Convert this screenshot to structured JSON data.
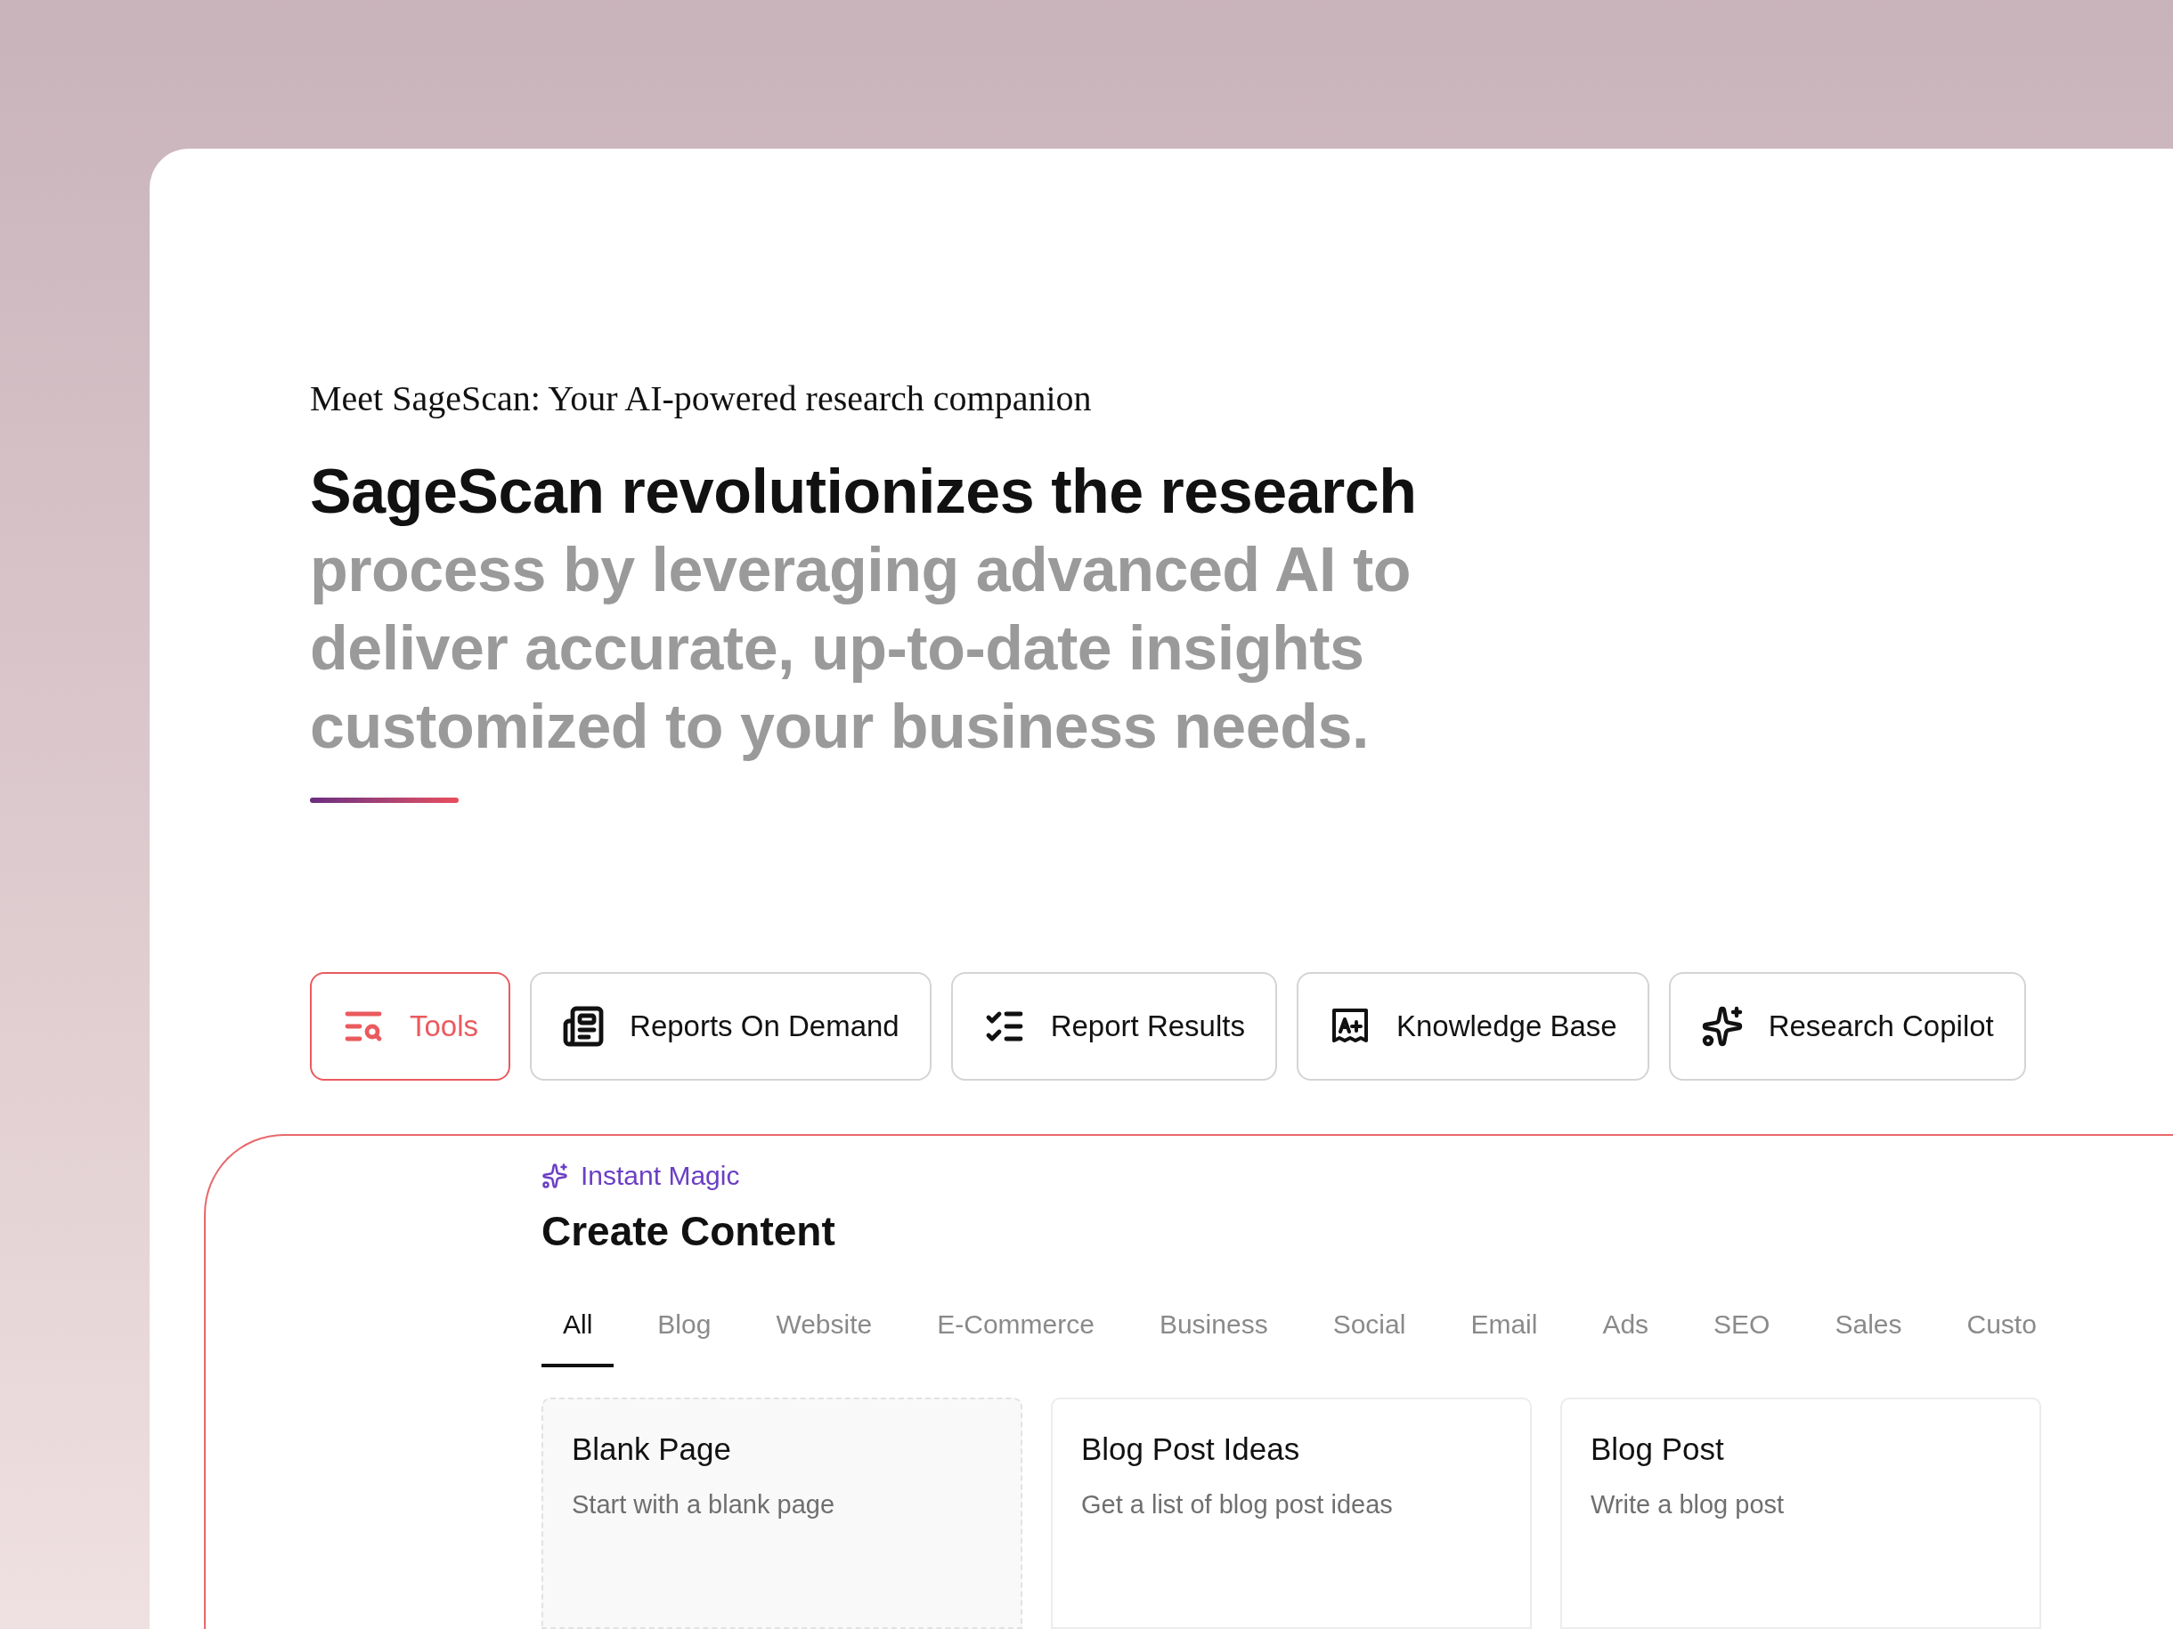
{
  "intro": {
    "eyebrow": "Meet SageScan: Your AI-powered research companion",
    "headline_lead": "SageScan revolutionizes the research",
    "headline_rest": "process by leveraging advanced AI to deliver accurate, up-to-date insights customized to your business needs."
  },
  "features": [
    {
      "label": "Tools",
      "kind": "tools",
      "selected": true
    },
    {
      "label": "Reports On Demand",
      "kind": "report",
      "selected": false
    },
    {
      "label": "Report Results",
      "kind": "checklist",
      "selected": false
    },
    {
      "label": "Knowledge Base",
      "kind": "knowledge",
      "selected": false
    },
    {
      "label": "Research Copilot",
      "kind": "copilot",
      "selected": false
    }
  ],
  "content": {
    "eyebrow": "Instant Magic",
    "title": "Create Content",
    "tabs": [
      {
        "label": "All",
        "selected": true
      },
      {
        "label": "Blog",
        "selected": false
      },
      {
        "label": "Website",
        "selected": false
      },
      {
        "label": "E-Commerce",
        "selected": false
      },
      {
        "label": "Business",
        "selected": false
      },
      {
        "label": "Social",
        "selected": false
      },
      {
        "label": "Email",
        "selected": false
      },
      {
        "label": "Ads",
        "selected": false
      },
      {
        "label": "SEO",
        "selected": false
      },
      {
        "label": "Sales",
        "selected": false
      },
      {
        "label": "Custo",
        "selected": false
      }
    ],
    "cards": [
      {
        "title": "Blank Page",
        "description": "Start with a blank page",
        "kind": "blank"
      },
      {
        "title": "Blog Post Ideas",
        "description": "Get a list of blog post ideas",
        "kind": "template"
      },
      {
        "title": "Blog Post",
        "description": "Write a blog post",
        "kind": "template"
      }
    ]
  }
}
